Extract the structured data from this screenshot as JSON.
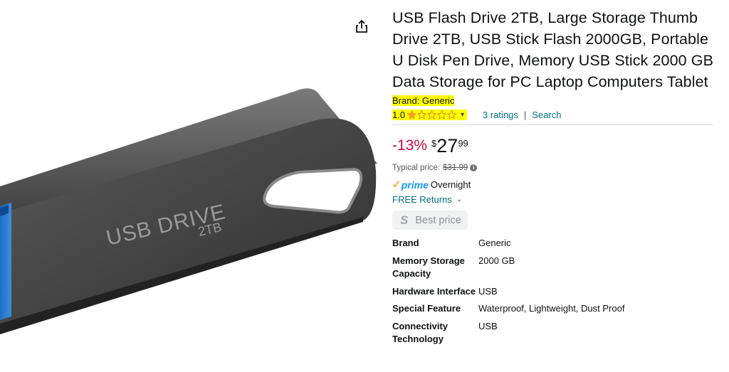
{
  "product": {
    "title": "USB Flash Drive 2TB, Large Storage Thumb Drive 2TB, USB Stick Flash 2000GB, Portable U Disk Pen Drive, Memory USB Stick 2000 GB Data Storage for PC Laptop Computers Tablet",
    "brand_label": "Brand: Generic",
    "image_text_main": "USB DRIVE",
    "image_text_sub": "2TB"
  },
  "rating": {
    "value": "1.0",
    "stars_filled": 1,
    "stars_total": 5,
    "ratings_link": "3 ratings",
    "separator": "|",
    "search_link": "Search"
  },
  "price": {
    "discount": "-13%",
    "currency": "$",
    "whole": "27",
    "fraction": "99",
    "typical_label": "Typical price:",
    "typical_value": "$31.99"
  },
  "delivery": {
    "prime_word": "prime",
    "prime_text": "Overnight",
    "returns_link": "FREE Returns"
  },
  "best_price": {
    "label": "Best price",
    "icon": "S"
  },
  "specs": [
    {
      "key": "Brand",
      "value": "Generic"
    },
    {
      "key": "Memory Storage Capacity",
      "value": "2000 GB"
    },
    {
      "key": "Hardware Interface",
      "value": "USB"
    },
    {
      "key": "Special Feature",
      "value": "Waterproof, Lightweight, Dust Proof"
    },
    {
      "key": "Connectivity Technology",
      "value": "USB"
    }
  ],
  "icons": {
    "share": "share-icon",
    "star_color": "#ffa41c",
    "link_color": "#007185",
    "discount_color": "#cc0c39",
    "highlight_color": "#ffff00"
  }
}
